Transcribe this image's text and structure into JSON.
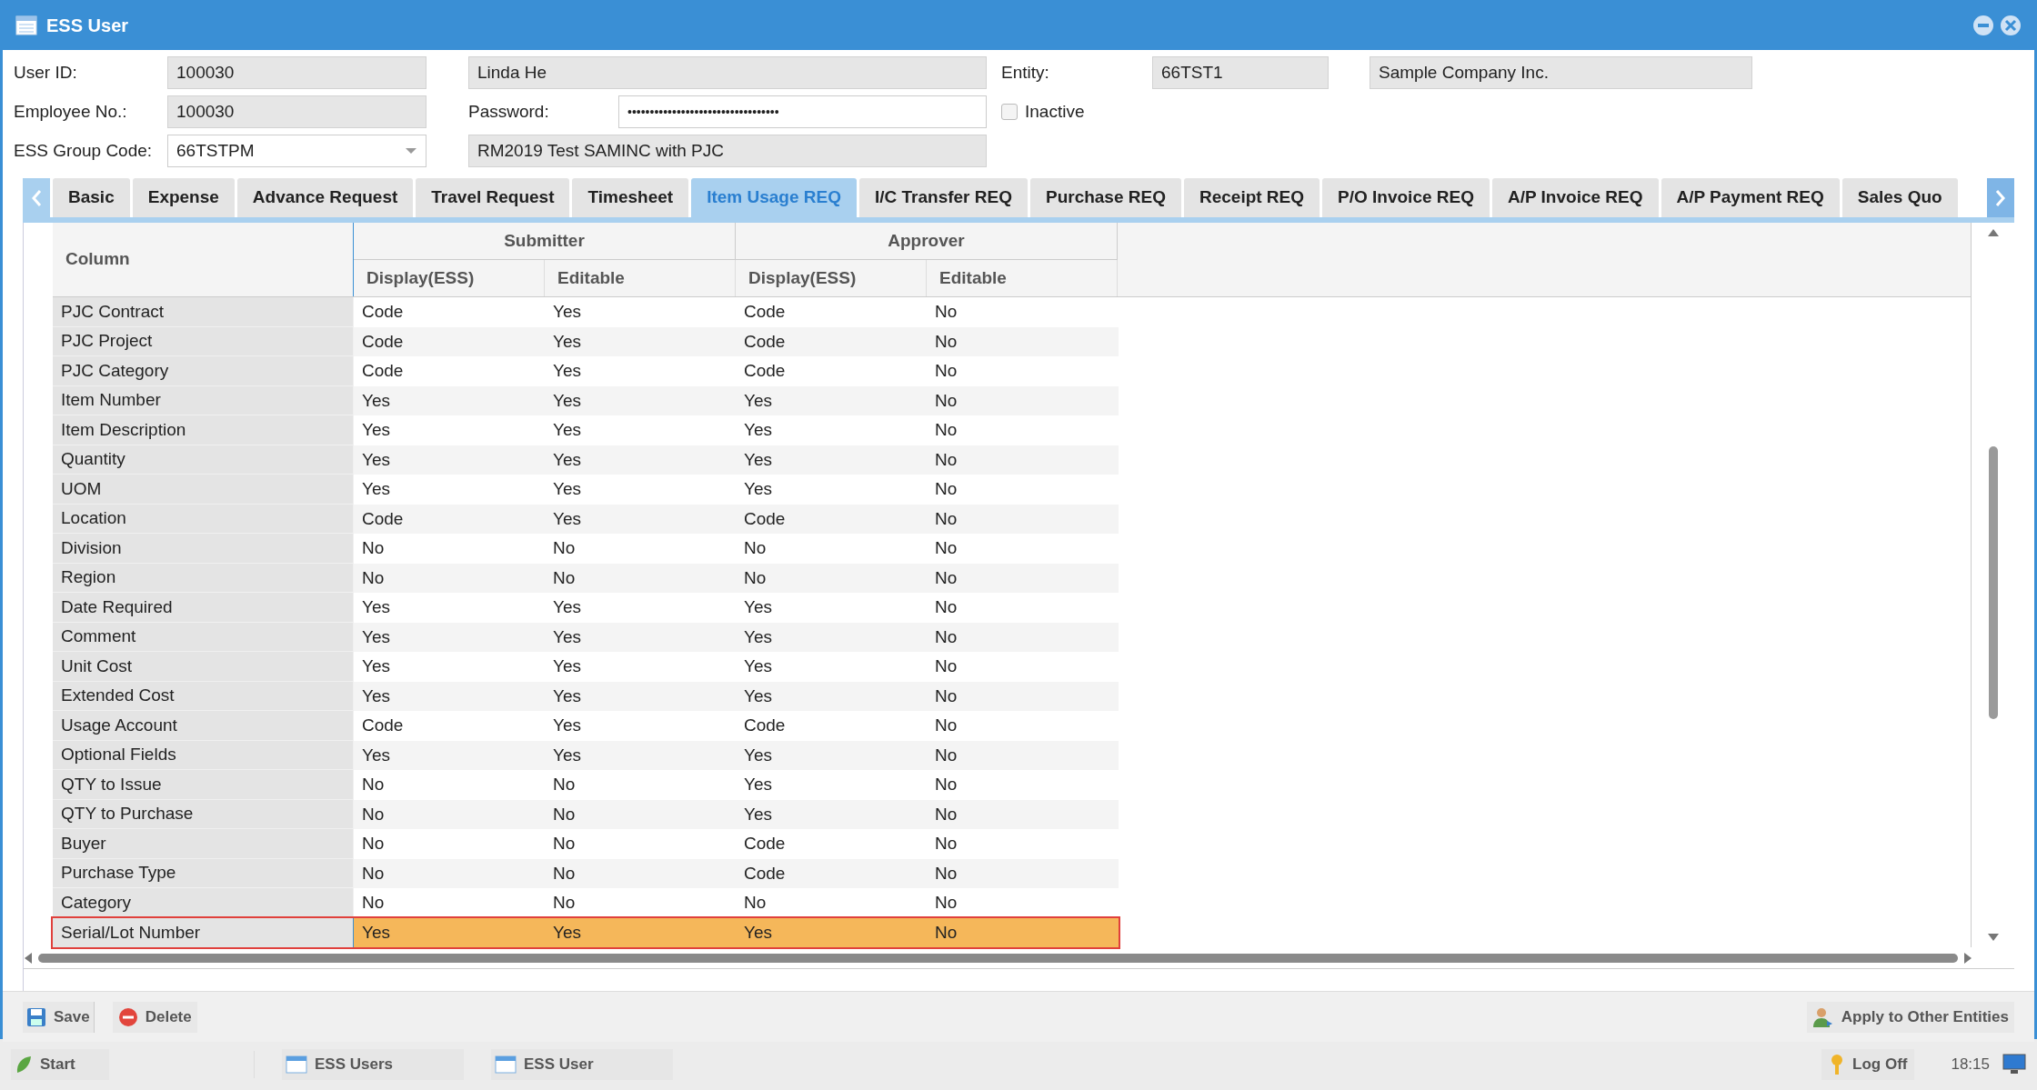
{
  "window": {
    "title": "ESS User"
  },
  "header": {
    "user_id_label": "User ID:",
    "user_id": "100030",
    "name": "Linda He",
    "entity_label": "Entity:",
    "entity": "66TST1",
    "company": "Sample Company Inc.",
    "employee_no_label": "Employee No.:",
    "employee_no": "100030",
    "password_label": "Password:",
    "password": "••••••••••••••••••••••••••••••••••",
    "inactive_label": "Inactive",
    "inactive": false,
    "group_code_label": "ESS Group Code:",
    "group_code": "66TSTPM",
    "group_description": "RM2019 Test SAMINC with PJC"
  },
  "tabs": [
    {
      "label": "Basic",
      "selected": false
    },
    {
      "label": "Expense",
      "selected": false
    },
    {
      "label": "Advance Request",
      "selected": false
    },
    {
      "label": "Travel Request",
      "selected": false
    },
    {
      "label": "Timesheet",
      "selected": false
    },
    {
      "label": "Item Usage REQ",
      "selected": true
    },
    {
      "label": "I/C Transfer REQ",
      "selected": false
    },
    {
      "label": "Purchase REQ",
      "selected": false
    },
    {
      "label": "Receipt REQ",
      "selected": false
    },
    {
      "label": "P/O Invoice REQ",
      "selected": false
    },
    {
      "label": "A/P Invoice REQ",
      "selected": false
    },
    {
      "label": "A/P Payment REQ",
      "selected": false
    },
    {
      "label": "Sales Quo",
      "selected": false
    }
  ],
  "table": {
    "groups": [
      "Submitter",
      "Approver"
    ],
    "columns": [
      "Column",
      "Display(ESS)",
      "Editable",
      "Display(ESS)",
      "Editable"
    ],
    "rows": [
      {
        "cells": [
          "PJC Contract",
          "Code",
          "Yes",
          "Code",
          "No"
        ],
        "selected": false
      },
      {
        "cells": [
          "PJC Project",
          "Code",
          "Yes",
          "Code",
          "No"
        ],
        "selected": false
      },
      {
        "cells": [
          "PJC Category",
          "Code",
          "Yes",
          "Code",
          "No"
        ],
        "selected": false
      },
      {
        "cells": [
          "Item Number",
          "Yes",
          "Yes",
          "Yes",
          "No"
        ],
        "selected": false
      },
      {
        "cells": [
          "Item Description",
          "Yes",
          "Yes",
          "Yes",
          "No"
        ],
        "selected": false
      },
      {
        "cells": [
          "Quantity",
          "Yes",
          "Yes",
          "Yes",
          "No"
        ],
        "selected": false
      },
      {
        "cells": [
          "UOM",
          "Yes",
          "Yes",
          "Yes",
          "No"
        ],
        "selected": false
      },
      {
        "cells": [
          "Location",
          "Code",
          "Yes",
          "Code",
          "No"
        ],
        "selected": false
      },
      {
        "cells": [
          "Division",
          "No",
          "No",
          "No",
          "No"
        ],
        "selected": false
      },
      {
        "cells": [
          "Region",
          "No",
          "No",
          "No",
          "No"
        ],
        "selected": false
      },
      {
        "cells": [
          "Date Required",
          "Yes",
          "Yes",
          "Yes",
          "No"
        ],
        "selected": false
      },
      {
        "cells": [
          "Comment",
          "Yes",
          "Yes",
          "Yes",
          "No"
        ],
        "selected": false
      },
      {
        "cells": [
          "Unit Cost",
          "Yes",
          "Yes",
          "Yes",
          "No"
        ],
        "selected": false
      },
      {
        "cells": [
          "Extended Cost",
          "Yes",
          "Yes",
          "Yes",
          "No"
        ],
        "selected": false
      },
      {
        "cells": [
          "Usage Account",
          "Code",
          "Yes",
          "Code",
          "No"
        ],
        "selected": false
      },
      {
        "cells": [
          "Optional Fields",
          "Yes",
          "Yes",
          "Yes",
          "No"
        ],
        "selected": false
      },
      {
        "cells": [
          "QTY to Issue",
          "No",
          "No",
          "Yes",
          "No"
        ],
        "selected": false
      },
      {
        "cells": [
          "QTY to Purchase",
          "No",
          "No",
          "Yes",
          "No"
        ],
        "selected": false
      },
      {
        "cells": [
          "Buyer",
          "No",
          "No",
          "Code",
          "No"
        ],
        "selected": false
      },
      {
        "cells": [
          "Purchase Type",
          "No",
          "No",
          "Code",
          "No"
        ],
        "selected": false
      },
      {
        "cells": [
          "Category",
          "No",
          "No",
          "No",
          "No"
        ],
        "selected": false
      },
      {
        "cells": [
          "Serial/Lot Number",
          "Yes",
          "Yes",
          "Yes",
          "No"
        ],
        "selected": true
      }
    ]
  },
  "toolbar": {
    "save": "Save",
    "delete": "Delete",
    "apply": "Apply to Other Entities"
  },
  "taskbar": {
    "start": "Start",
    "windows": [
      "ESS Users",
      "ESS User"
    ],
    "log_off": "Log Off",
    "time": "18:15"
  }
}
